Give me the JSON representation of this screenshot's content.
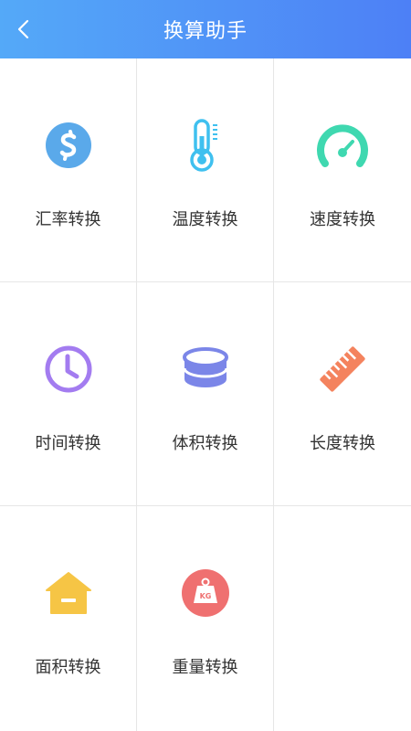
{
  "header": {
    "title": "换算助手",
    "back_icon": "chevron-left-icon",
    "gradient_start": "#54a9f8",
    "gradient_end": "#4d80f6"
  },
  "tools": [
    {
      "label": "汇率转换",
      "icon": "currency-icon",
      "color": "#5aa9ea"
    },
    {
      "label": "温度转换",
      "icon": "thermometer-icon",
      "color": "#3fc0ef"
    },
    {
      "label": "速度转换",
      "icon": "speedometer-icon",
      "color": "#3fd8b0"
    },
    {
      "label": "时间转换",
      "icon": "clock-icon",
      "color": "#a37cf0"
    },
    {
      "label": "体积转换",
      "icon": "volume-cylinder-icon",
      "color": "#7b86e8"
    },
    {
      "label": "长度转换",
      "icon": "ruler-icon",
      "color": "#f4835e"
    },
    {
      "label": "面积转换",
      "icon": "house-icon",
      "color": "#f6c545"
    },
    {
      "label": "重量转换",
      "icon": "weight-icon",
      "color": "#ef7070"
    }
  ]
}
